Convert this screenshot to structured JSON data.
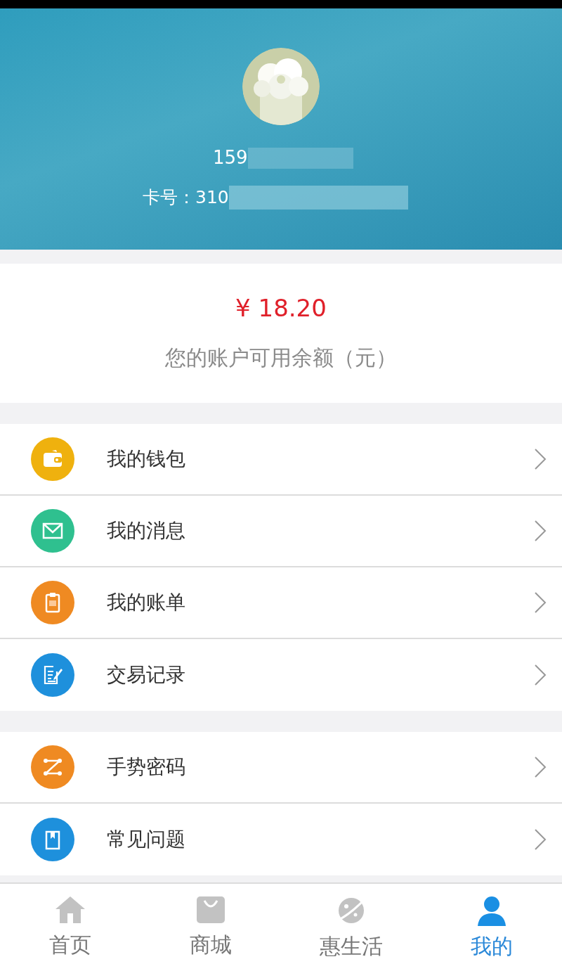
{
  "profile": {
    "phone": "159",
    "card_label": "卡号：310"
  },
  "balance": {
    "amount": "¥ 18.20",
    "caption": "您的账户可用余额（元）"
  },
  "menu_groups": [
    {
      "items": [
        {
          "label": "我的钱包",
          "color": "#efb10e"
        },
        {
          "label": "我的消息",
          "color": "#2fc08f"
        },
        {
          "label": "我的账单",
          "color": "#ef8a22"
        },
        {
          "label": "交易记录",
          "color": "#1e90dc"
        }
      ]
    },
    {
      "items": [
        {
          "label": "手势密码",
          "color": "#ef8a22"
        },
        {
          "label": "常见问题",
          "color": "#1e90dc"
        }
      ]
    }
  ],
  "tab_bar": [
    {
      "label": "首页",
      "selected": false
    },
    {
      "label": "商城",
      "selected": false
    },
    {
      "label": "惠生活",
      "selected": false
    },
    {
      "label": "我的",
      "selected": true
    }
  ]
}
